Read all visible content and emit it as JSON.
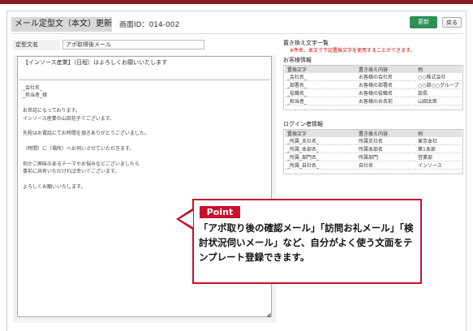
{
  "header": {
    "title": "メール定型文（本文）更新",
    "screen_id": "画面ID：014-002",
    "update_button": "更新",
    "back_button": "戻る"
  },
  "form": {
    "name_label": "定型文名",
    "name_value": "アポ取得後メール",
    "subject": "【インソース産業】（日程）はよろしくお願いいたします",
    "body_lines": [
      "_会社名_",
      "_担当者_様",
      "",
      "お世話になっております。",
      "インソース産業の山田花子でございます。",
      "",
      "先程はお電話にてお時間を頂きありがとうございました。",
      "",
      "（時間）に（場所）へお伺いさせていただきます。",
      "",
      "何かご興味のあるテーマやお悩みなどございましたら",
      "事前に共有いただければ幸いでございます。",
      "",
      "よろしくお願いいたします。"
    ]
  },
  "replacement": {
    "title": "置き換え文字一覧",
    "note": "※件名、本文で下記置換文字を使用することができます。",
    "groups": [
      {
        "title": "お客様情報",
        "headers": [
          "置換文字",
          "置き換え内容",
          "例"
        ],
        "rows": [
          [
            "_会社名_",
            "お客様の会社名",
            "○○株式会社"
          ],
          [
            "_部署名_",
            "お客様の部署名",
            "○○部○○グループ"
          ],
          [
            "_役職名_",
            "お客様の役職名",
            "部長"
          ],
          [
            "_担当者_",
            "お客様のお名前",
            "山田太郎"
          ]
        ]
      },
      {
        "title": "ログイン者情報",
        "headers": [
          "置換文字",
          "置き換え内容",
          "例"
        ],
        "rows": [
          [
            "_所属_支社名_",
            "所属支社名",
            "東京本社"
          ],
          [
            "_所属_本部名_",
            "所属本部名",
            "第1本部"
          ],
          [
            "_所属_部門名_",
            "所属部門",
            "営業部"
          ],
          [
            "_所属_自社名_",
            "自社名",
            "インソース"
          ]
        ]
      }
    ]
  },
  "point": {
    "label": "Point",
    "text": "「アポ取り後の確認メール」「訪問お礼メール」「検討状況伺いメール」など、自分がよく使う文面をテンプレート登録できます。"
  },
  "colors": {
    "brand_bar": "#8a1d24",
    "update_button": "#2e8f57",
    "point_accent": "#c8102e"
  }
}
